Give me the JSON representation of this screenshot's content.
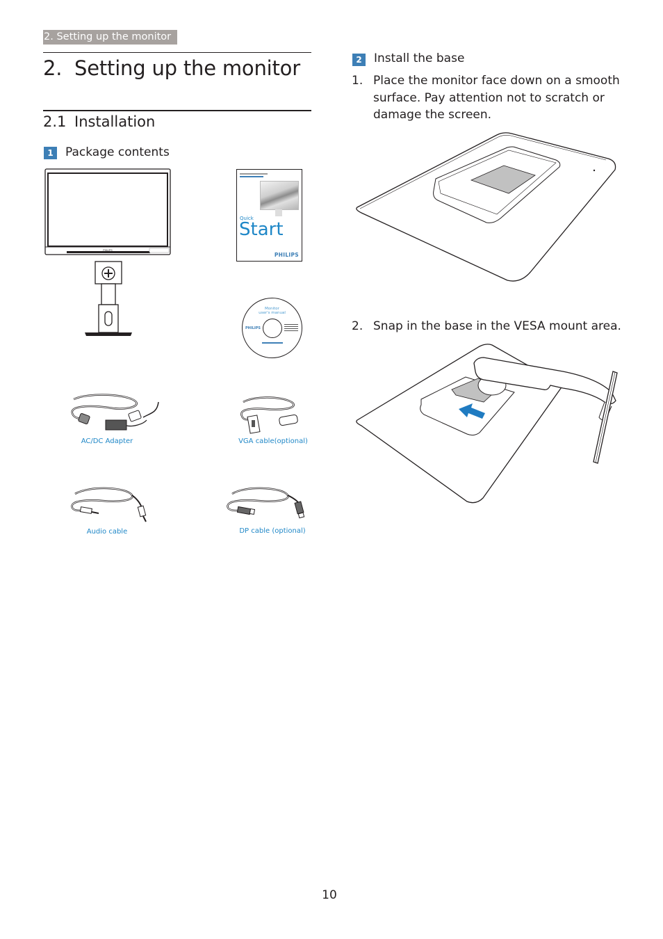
{
  "header": {
    "breadcrumb": "2. Setting up the monitor"
  },
  "chapter": {
    "number": "2.",
    "title": "Setting up the monitor"
  },
  "section": {
    "number": "2.1",
    "title": "Installation"
  },
  "package_contents": {
    "badge": "1",
    "title": "Package contents",
    "items": [
      {
        "name": "Monitor with stand",
        "caption": ""
      },
      {
        "name": "Quick Start guide",
        "caption": ""
      },
      {
        "name": "User's manual CD",
        "caption": ""
      },
      {
        "name": "AC/DC Adapter",
        "caption": "AC/DC Adapter"
      },
      {
        "name": "VGA cable",
        "caption": "VGA cable(optional)"
      },
      {
        "name": "Audio cable",
        "caption": "Audio cable"
      },
      {
        "name": "DP cable",
        "caption": "DP cable (optional)"
      }
    ],
    "quick_start": {
      "line1": "Quick",
      "line2": "Start",
      "brand": "PHILIPS"
    },
    "cd": {
      "line1": "Monitor",
      "line2": "user's manual",
      "brand": "PHILIPS"
    },
    "monitor_brand": "PHILIPS"
  },
  "install_base": {
    "badge": "2",
    "title": "Install the base",
    "steps": [
      {
        "number": "1.",
        "text": "Place the monitor face down on a smooth surface. Pay attention not to scratch or damage the screen."
      },
      {
        "number": "2.",
        "text": "Snap in the base in the VESA mount area."
      }
    ]
  },
  "colors": {
    "accent_blue": "#3d7fb6",
    "caption_blue": "#1f87c7",
    "breadcrumb_gray": "#a7a29f"
  },
  "footer": {
    "page_number": "10"
  }
}
